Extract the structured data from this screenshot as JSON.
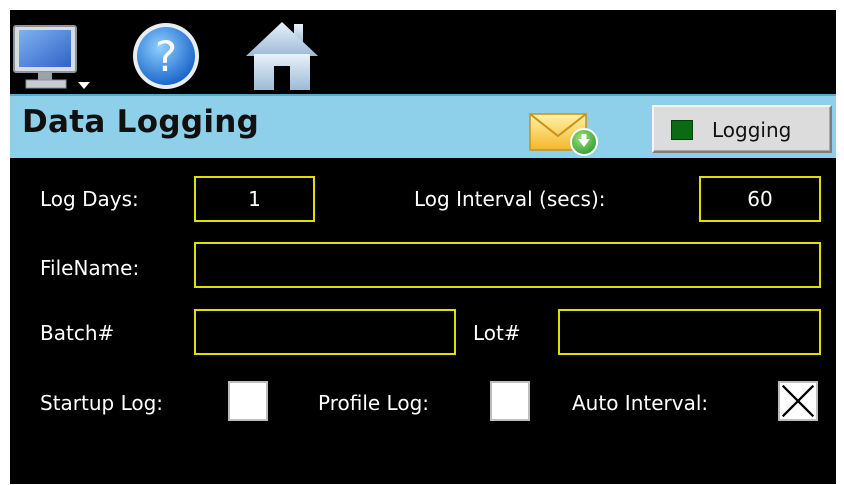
{
  "toolbar": {
    "items": [
      {
        "name": "monitor-menu",
        "icon": "monitor-icon"
      },
      {
        "name": "help",
        "icon": "help-icon"
      },
      {
        "name": "home",
        "icon": "home-icon"
      }
    ]
  },
  "header": {
    "title": "Data Logging",
    "email_icon": "email-download-icon",
    "logging_button": {
      "label": "Logging",
      "indicator_color": "#0b6b14"
    }
  },
  "form": {
    "log_days": {
      "label": "Log Days:",
      "value": "1"
    },
    "log_interval": {
      "label": "Log Interval (secs):",
      "value": "60"
    },
    "filename": {
      "label": "FileName:",
      "value": ""
    },
    "batch": {
      "label": "Batch#",
      "value": ""
    },
    "lot": {
      "label": "Lot#",
      "value": ""
    },
    "startup_log": {
      "label": "Startup Log:",
      "checked": false
    },
    "profile_log": {
      "label": "Profile Log:",
      "checked": false
    },
    "auto_interval": {
      "label": "Auto Interval:",
      "checked": true
    }
  },
  "colors": {
    "background": "#000000",
    "title_bar": "#8ecfea",
    "field_border": "#e0e000",
    "text": "#ffffff"
  }
}
